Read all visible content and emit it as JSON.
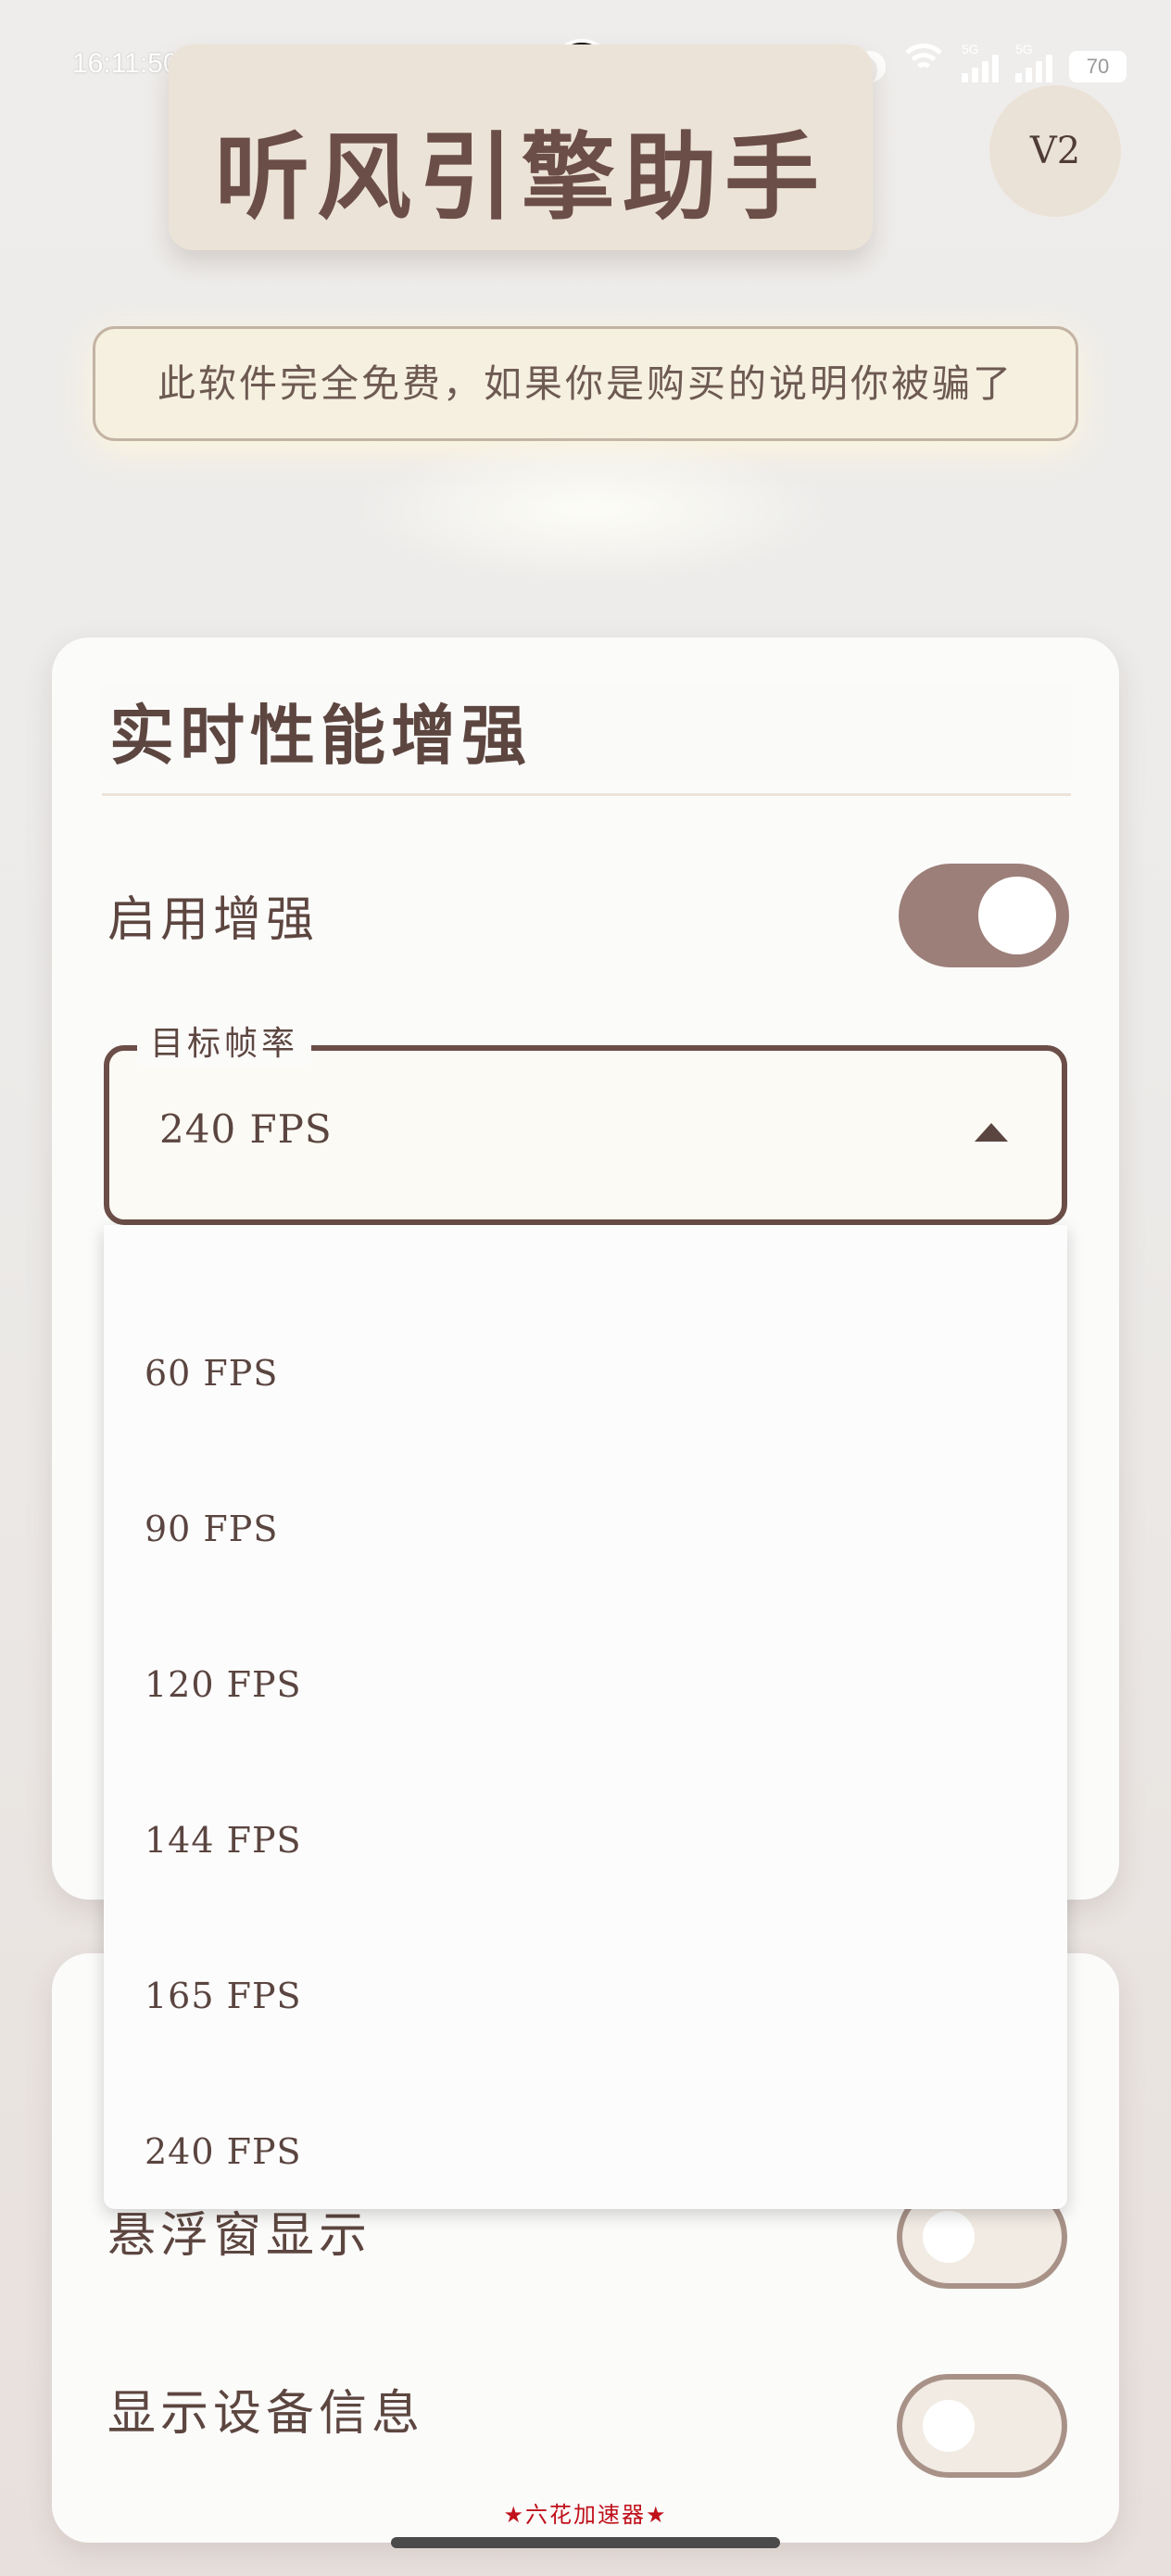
{
  "status_bar": {
    "time": "16:11:50",
    "network_tags": [
      "5G",
      "5G"
    ],
    "battery": "70",
    "icons": [
      "qq-icon",
      "video-app-icon",
      "browser-app-icon",
      "baidu-icon",
      "camera-icon",
      "moon-icon",
      "wifi-icon",
      "signal-icon",
      "battery-icon"
    ]
  },
  "header": {
    "title": "听风引擎助手",
    "version": "V2"
  },
  "notice": "此软件完全免费，如果你是购买的说明你被骗了",
  "performance_card": {
    "title": "实时性能增强",
    "enable_label": "启用增强",
    "enable_on": true,
    "target_fps": {
      "legend": "目标帧率",
      "value": "240 FPS",
      "options": [
        "60 FPS",
        "90 FPS",
        "120 FPS",
        "144 FPS",
        "165 FPS",
        "240 FPS"
      ]
    }
  },
  "display_card": {
    "floating_window_label": "悬浮窗显示",
    "floating_window_on": false,
    "device_info_label": "显示设备信息",
    "device_info_on": false
  },
  "footer": "★六花加速器★",
  "colors": {
    "accent": "#6b4e47",
    "switch_on": "#9c7f79",
    "notice_bg": "#f6f0e1",
    "footer_red": "#c0101a"
  }
}
